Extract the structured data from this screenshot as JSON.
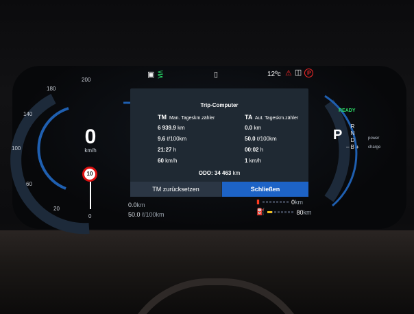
{
  "speedometer": {
    "speed_value": "0",
    "speed_unit": "km/h",
    "speed_limit": "10",
    "ticks": [
      "0",
      "20",
      "60",
      "100",
      "140",
      "180",
      "200"
    ]
  },
  "status_bar": {
    "icons": [
      "headlight-icon",
      "parking-light-icon",
      "door-icon"
    ],
    "outside_temp": "12ºc",
    "warnings": [
      "seatbelt-warning-icon",
      "parking-brake-icon"
    ]
  },
  "trip_computer": {
    "title": "Trip-Computer",
    "tm": {
      "code": "TM",
      "label": "Man. Tageskm.zähler",
      "distance": "6 939.9",
      "distance_unit": "km",
      "consumption": "9.6",
      "consumption_unit": "ℓ/100km",
      "time": "21:27",
      "time_unit": "h",
      "avg_speed": "60",
      "avg_speed_unit": "km/h"
    },
    "ta": {
      "code": "TA",
      "label": "Aut. Tageskm.zähler",
      "distance": "0.0",
      "distance_unit": "km",
      "consumption": "50.0",
      "consumption_unit": "ℓ/100km",
      "time": "00:02",
      "time_unit": "h",
      "avg_speed": "1",
      "avg_speed_unit": "km/h"
    },
    "odo_label": "ODO:",
    "odo_value": "34 463",
    "odo_unit": "km",
    "reset_button": "TM zurücksetzen",
    "close_button": "Schließen"
  },
  "trip_summary": {
    "distance": "0.0",
    "distance_unit": "km",
    "consumption": "50.0",
    "consumption_unit": "ℓ/100km"
  },
  "drive_status": {
    "ready": "READY",
    "current_gear": "P",
    "gears": [
      "R",
      "N",
      "D"
    ],
    "b_mode": "– B +",
    "power_label": "power",
    "charge_label": "charge"
  },
  "range": {
    "electric_value": "0",
    "electric_unit": "km",
    "fuel_value": "80",
    "fuel_unit": "km",
    "fuel_level": 0.18
  }
}
